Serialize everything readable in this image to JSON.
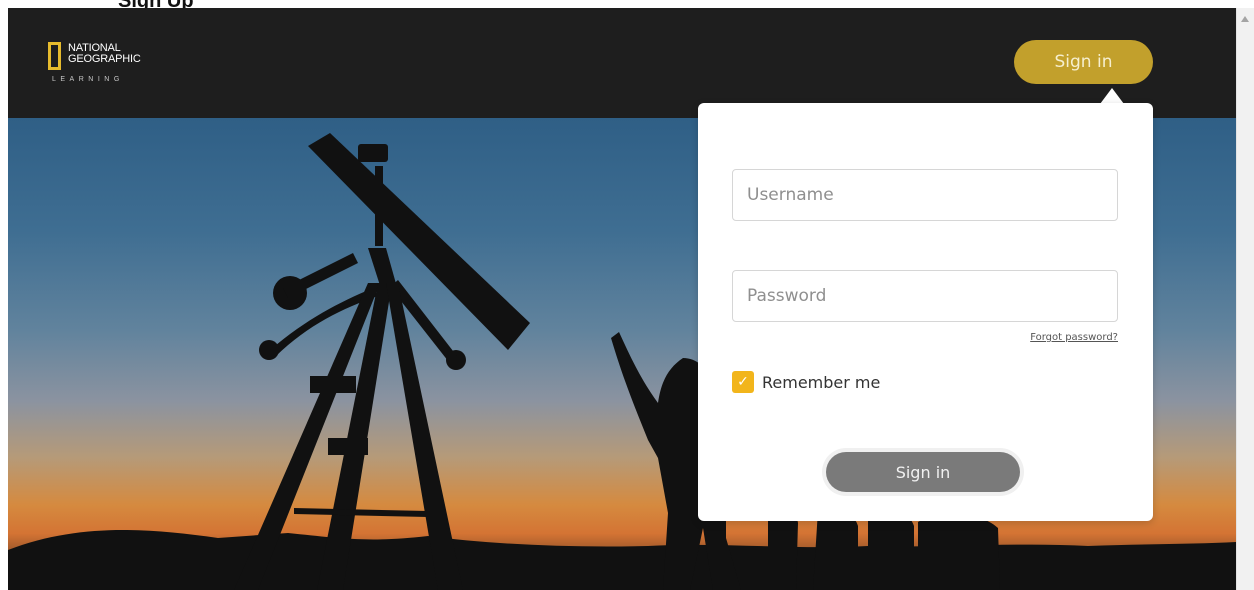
{
  "page": {
    "top_cut_text": "Sign Up"
  },
  "header": {
    "logo": {
      "line1": "NATIONAL",
      "line2": "GEOGRAPHIC",
      "subtitle": "LEARNING"
    },
    "signin_label": "Sign in"
  },
  "login": {
    "username_placeholder": "Username",
    "password_placeholder": "Password",
    "forgot_label": "Forgot password?",
    "remember_label": "Remember me",
    "remember_checked": true,
    "submit_label": "Sign in"
  },
  "colors": {
    "brand_gold": "#c2a02c",
    "checkbox_gold": "#f2b51b",
    "button_gray": "#7a7a7a"
  },
  "icons": {
    "checkbox": "check-icon",
    "scroll_up": "scroll-up-icon"
  }
}
